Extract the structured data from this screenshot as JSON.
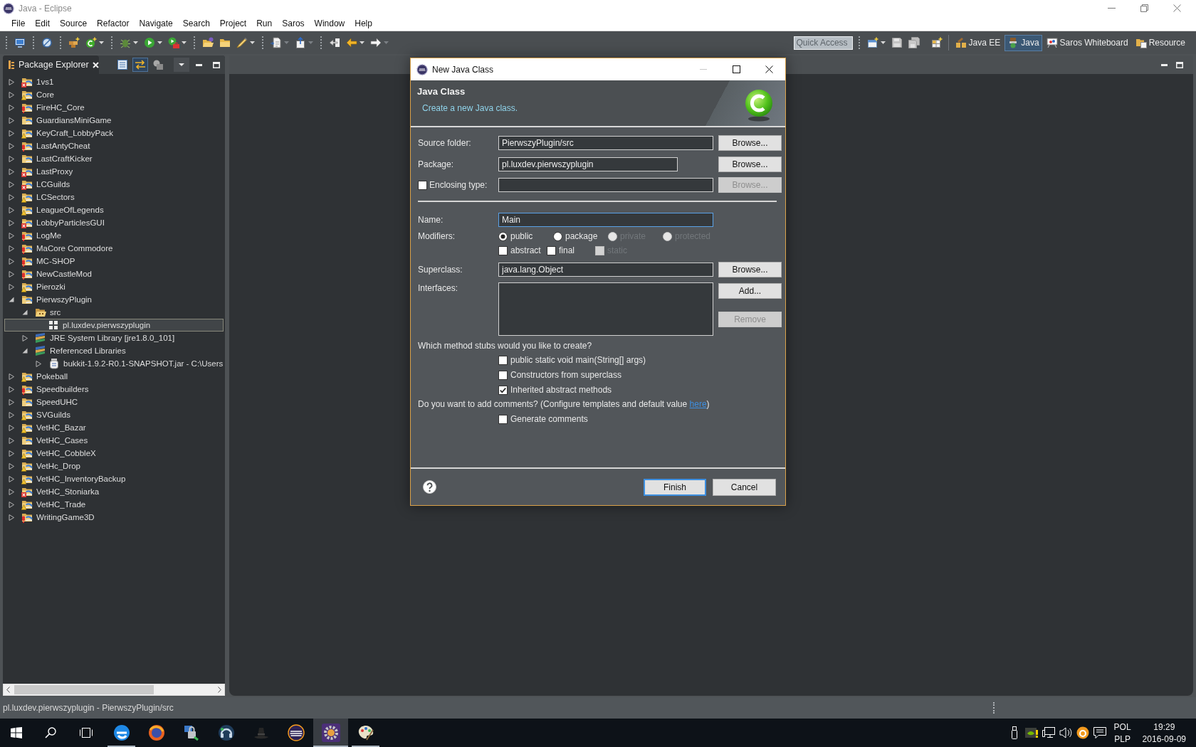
{
  "window": {
    "title": "Java - Eclipse"
  },
  "menu": [
    "File",
    "Edit",
    "Source",
    "Refactor",
    "Navigate",
    "Search",
    "Project",
    "Run",
    "Saros",
    "Window",
    "Help"
  ],
  "toolbar": {
    "quick_access": {
      "placeholder": "Quick Access"
    },
    "perspectives": [
      {
        "label": "Java EE",
        "kind": "enterprise",
        "selected": false
      },
      {
        "label": "Java",
        "kind": "java",
        "selected": true
      },
      {
        "label": "Saros Whiteboard",
        "kind": "whiteboard",
        "selected": false
      },
      {
        "label": "Resource",
        "kind": "resource",
        "selected": false
      }
    ]
  },
  "package_explorer": {
    "tab": {
      "label": "Package Explorer"
    },
    "view_toolbar": [
      {
        "kind": "collapse",
        "pressed": false
      },
      {
        "kind": "link",
        "pressed": true
      },
      {
        "kind": "focus",
        "pressed": false
      }
    ],
    "tree": [
      {
        "label": "1vs1",
        "kind": "project-error",
        "expanded": false,
        "selected": false
      },
      {
        "label": "Core",
        "kind": "project-warning",
        "expanded": false,
        "selected": false
      },
      {
        "label": "FireHC_Core",
        "kind": "project-problem",
        "expanded": false,
        "selected": false
      },
      {
        "label": "GuardiansMiniGame",
        "kind": "project",
        "expanded": false,
        "selected": false
      },
      {
        "label": "KeyCraft_LobbyPack",
        "kind": "project-warning",
        "expanded": false,
        "selected": false
      },
      {
        "label": "LastAntyCheat",
        "kind": "project-problem",
        "expanded": false,
        "selected": false
      },
      {
        "label": "LastCraftKicker",
        "kind": "project",
        "expanded": false,
        "selected": false
      },
      {
        "label": "LastProxy",
        "kind": "project-error",
        "expanded": false,
        "selected": false
      },
      {
        "label": "LCGuilds",
        "kind": "project-error",
        "expanded": false,
        "selected": false
      },
      {
        "label": "LCSectors",
        "kind": "project-warning",
        "expanded": false,
        "selected": false
      },
      {
        "label": "LeagueOfLegends",
        "kind": "project-warning",
        "expanded": false,
        "selected": false
      },
      {
        "label": "LobbyParticlesGUI",
        "kind": "project-error",
        "expanded": false,
        "selected": false
      },
      {
        "label": "LogMe",
        "kind": "project-problem",
        "expanded": false,
        "selected": false
      },
      {
        "label": "MaCore Commodore",
        "kind": "project-problem",
        "expanded": false,
        "selected": false
      },
      {
        "label": "MC-SHOP",
        "kind": "project-problem",
        "expanded": false,
        "selected": false
      },
      {
        "label": "NewCastleMod",
        "kind": "project-problem",
        "expanded": false,
        "selected": false
      },
      {
        "label": "Pierozki",
        "kind": "project-warning",
        "expanded": false,
        "selected": false
      },
      {
        "label": "PierwszyPlugin",
        "kind": "project",
        "expanded": true,
        "selected": false,
        "children": [
          {
            "label": "src",
            "kind": "source-folder",
            "expanded": true,
            "selected": false,
            "children": [
              {
                "label": "pl.luxdev.pierwszyplugin",
                "kind": "package",
                "selected": true
              }
            ]
          },
          {
            "label": "JRE System Library [jre1.8.0_101]",
            "kind": "library",
            "expanded": false,
            "selected": false
          },
          {
            "label": "Referenced Libraries",
            "kind": "library",
            "expanded": true,
            "selected": false,
            "children": [
              {
                "label": "bukkit-1.9.2-R0.1-SNAPSHOT.jar - C:\\Users",
                "kind": "jar",
                "expanded": false,
                "selected": false
              }
            ]
          }
        ]
      },
      {
        "label": "Pokeball",
        "kind": "project-warning",
        "expanded": false,
        "selected": false
      },
      {
        "label": "Speedbuilders",
        "kind": "project-problem",
        "expanded": false,
        "selected": false
      },
      {
        "label": "SpeedUHC",
        "kind": "project",
        "expanded": false,
        "selected": false
      },
      {
        "label": "SVGuilds",
        "kind": "project-warning",
        "expanded": false,
        "selected": false
      },
      {
        "label": "VetHC_Bazar",
        "kind": "project-warning",
        "expanded": false,
        "selected": false
      },
      {
        "label": "VetHC_Cases",
        "kind": "project",
        "expanded": false,
        "selected": false
      },
      {
        "label": "VetHC_CobbleX",
        "kind": "project-warning",
        "expanded": false,
        "selected": false
      },
      {
        "label": "VetHc_Drop",
        "kind": "project-warning",
        "expanded": false,
        "selected": false
      },
      {
        "label": "VetHC_InventoryBackup",
        "kind": "project-warning",
        "expanded": false,
        "selected": false
      },
      {
        "label": "VetHC_Stoniarka",
        "kind": "project-error",
        "expanded": false,
        "selected": false
      },
      {
        "label": "VetHC_Trade",
        "kind": "project-warning",
        "expanded": false,
        "selected": false
      },
      {
        "label": "WritingGame3D",
        "kind": "project-problem",
        "expanded": false,
        "selected": false
      }
    ]
  },
  "dialog": {
    "title": "New Java Class",
    "heading": "Java Class",
    "description": "Create a new Java class.",
    "source_folder": {
      "label": "Source folder:",
      "value": "PierwszyPlugin/src",
      "button": {
        "label": "Browse...",
        "disabled": false
      }
    },
    "package": {
      "label": "Package:",
      "value": "pl.luxdev.pierwszyplugin",
      "button": {
        "label": "Browse...",
        "disabled": false
      }
    },
    "enclosing_type": {
      "label": "Enclosing type:",
      "checked": false,
      "button": {
        "label": "Browse...",
        "disabled": true
      }
    },
    "name": {
      "label": "Name:",
      "value": "Main",
      "focused": true
    },
    "modifiers": {
      "label": "Modifiers:",
      "access": [
        {
          "label": "public",
          "selected": true,
          "disabled": false
        },
        {
          "label": "package",
          "selected": false,
          "disabled": false
        },
        {
          "label": "private",
          "selected": false,
          "disabled": true
        },
        {
          "label": "protected",
          "selected": false,
          "disabled": true
        }
      ],
      "flags": [
        {
          "label": "abstract",
          "checked": false,
          "disabled": false
        },
        {
          "label": "final",
          "checked": false,
          "disabled": false
        },
        {
          "label": "static",
          "checked": false,
          "disabled": true
        }
      ]
    },
    "superclass": {
      "label": "Superclass:",
      "value": "java.lang.Object",
      "button": {
        "label": "Browse...",
        "disabled": false
      }
    },
    "interfaces": {
      "label": "Interfaces:",
      "buttons": [
        {
          "label": "Add...",
          "disabled": false
        },
        {
          "label": "Remove",
          "disabled": true
        }
      ]
    },
    "stubs": {
      "question": "Which method stubs would you like to create?",
      "options": [
        {
          "label": "public static void main(String[] args)",
          "checked": false
        },
        {
          "label": "Constructors from superclass",
          "checked": false
        },
        {
          "label": "Inherited abstract methods",
          "checked": true
        }
      ]
    },
    "comments": {
      "question_start": "Do you want to add comments? (Configure templates and default value ",
      "link": "here",
      "question_end": ")",
      "options": [
        {
          "label": "Generate comments",
          "checked": false
        }
      ]
    },
    "buttons": [
      {
        "label": "Finish",
        "default": true
      },
      {
        "label": "Cancel",
        "default": false
      }
    ]
  },
  "status_bar": {
    "text": "pl.luxdev.pierwszyplugin - PierwszyPlugin/src"
  },
  "taskbar": {
    "apps": [
      {
        "kind": "browser",
        "running": true,
        "selected": false
      },
      {
        "kind": "globe",
        "running": false,
        "selected": false
      },
      {
        "kind": "padlock",
        "running": false,
        "selected": false
      },
      {
        "kind": "headset",
        "running": false,
        "selected": false
      },
      {
        "kind": "hat",
        "running": false,
        "selected": false
      },
      {
        "kind": "ring",
        "running": false,
        "selected": false
      },
      {
        "kind": "gear",
        "running": true,
        "selected": true
      },
      {
        "kind": "palette",
        "running": true,
        "selected": false
      }
    ],
    "language": "POL",
    "layout": "PLP",
    "time": "19:29",
    "date": "2016-09-09"
  }
}
